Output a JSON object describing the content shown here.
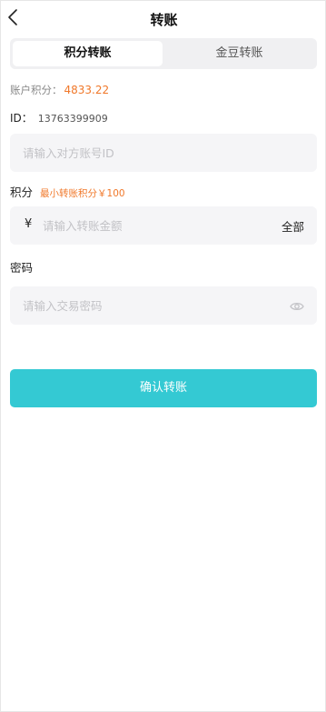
{
  "nav": {
    "title": "转账"
  },
  "tabs": [
    {
      "label": "积分转账",
      "active": true
    },
    {
      "label": "金豆转账",
      "active": false
    }
  ],
  "balance": {
    "label": "账户积分：",
    "value": "4833.22"
  },
  "id_row": {
    "label": "ID：",
    "value": "13763399909"
  },
  "recipient": {
    "placeholder": "请输入对方账号ID"
  },
  "points": {
    "label": "积分",
    "hint": "最小转账积分￥100"
  },
  "amount": {
    "currency": "¥",
    "placeholder": "请输入转账金额",
    "all_label": "全部"
  },
  "password": {
    "label": "密码",
    "placeholder": "请输入交易密码"
  },
  "confirm": {
    "label": "确认转账"
  },
  "colors": {
    "accent": "#34c9d3",
    "highlight": "#f0782a",
    "field_bg": "#f5f5f7"
  }
}
